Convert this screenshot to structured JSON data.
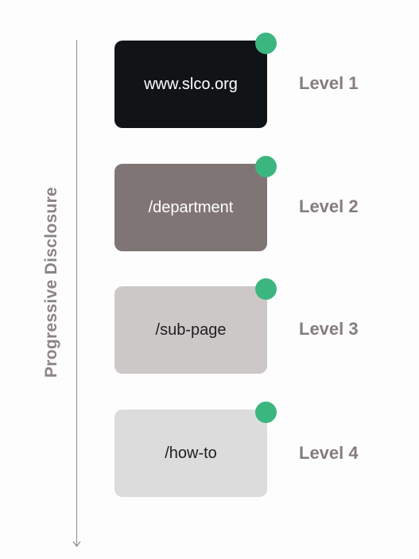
{
  "axis": {
    "label": "Progressive Disclosure",
    "line_color": "#8a8a8a",
    "label_color": "#8c8484"
  },
  "colors": {
    "dot": "#3cb67f",
    "level_label": "#857d7d"
  },
  "levels": [
    {
      "path": "www.slco.org",
      "level": "Level 1",
      "box_color": "#111416",
      "text_color": "#ffffff"
    },
    {
      "path": "/department",
      "level": "Level 2",
      "box_color": "#807575",
      "text_color": "#ffffff"
    },
    {
      "path": "/sub-page",
      "level": "Level 3",
      "box_color": "#ccc8c8",
      "text_color": "#1e1e1e"
    },
    {
      "path": "/how-to",
      "level": "Level 4",
      "box_color": "#dddcdc",
      "text_color": "#1e1e1e"
    }
  ]
}
